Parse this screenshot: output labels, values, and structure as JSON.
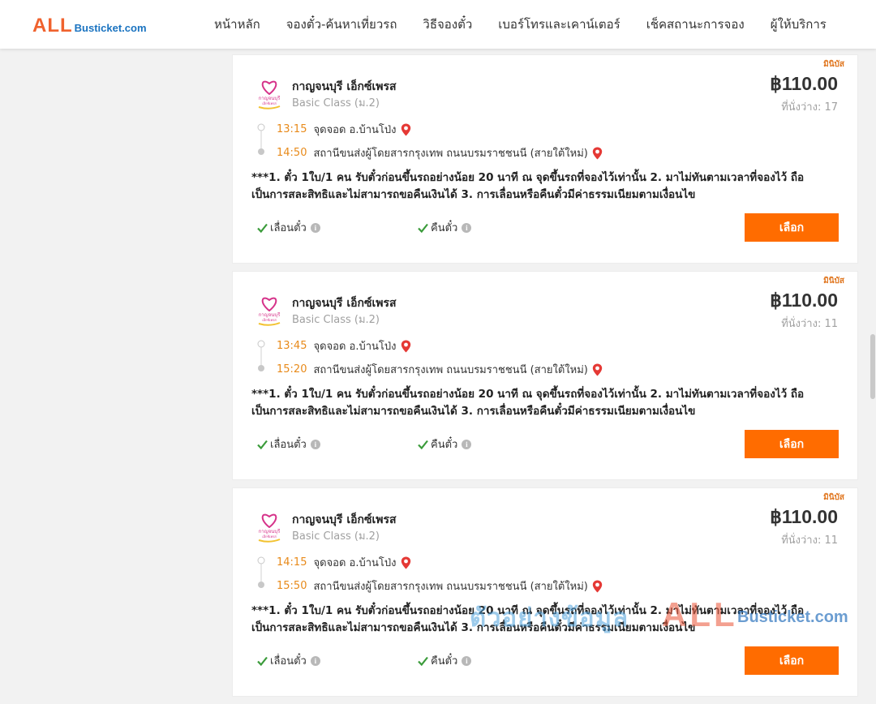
{
  "header": {
    "logo_all": "ALL",
    "logo_rest": "Busticket.com",
    "nav": [
      "หน้าหลัก",
      "จองตั๋ว-ค้นหาเที่ยวรถ",
      "วิธีจองตั๋ว",
      "เบอร์โทรและเคาน์เตอร์",
      "เช็คสถานะการจอง",
      "ผู้ให้บริการ"
    ]
  },
  "colors": {
    "accent_orange": "#ff6c00",
    "time_orange": "#e88a1a",
    "check_green": "#3a9b3a",
    "pin_red": "#e53935",
    "logo_red": "#f0622e",
    "logo_blue": "#1a73c0"
  },
  "cards": [
    {
      "tag": "มินิบัส",
      "operator": "กาญจนบุรี เอ็กซ์เพรส",
      "bus_class": "Basic Class (ม.2)",
      "price": "฿110.00",
      "seats": "ที่นั่งว่าง: 17",
      "dep_time": "13:15",
      "dep_place": "จุดจอด อ.บ้านโป่ง",
      "arr_time": "14:50",
      "arr_place": "สถานีขนส่งผู้โดยสารกรุงเทพ ถนนบรมราชชนนี (สายใต้ใหม่)",
      "note": "***1. ตั๋ว 1ใบ/1 คน รับตั๋วก่อนขึ้นรถอย่างน้อย 20 นาที ณ จุดขึ้นรถที่จองไว้เท่านั้น 2. มาไม่ทันตามเวลาที่จองไว้ ถือเป็นการสละสิทธิและไม่สามารถขอคืนเงินได้ 3. การเลื่อนหรือคืนตั๋วมีค่าธรรมเนียมตามเงื่อนไข",
      "feature1": "เลื่อนตั๋ว",
      "feature2": "คืนตั๋ว",
      "button": "เลือก"
    },
    {
      "tag": "มินิบัส",
      "operator": "กาญจนบุรี เอ็กซ์เพรส",
      "bus_class": "Basic Class (ม.2)",
      "price": "฿110.00",
      "seats": "ที่นั่งว่าง: 11",
      "dep_time": "13:45",
      "dep_place": "จุดจอด อ.บ้านโป่ง",
      "arr_time": "15:20",
      "arr_place": "สถานีขนส่งผู้โดยสารกรุงเทพ ถนนบรมราชชนนี (สายใต้ใหม่)",
      "note": "***1. ตั๋ว 1ใบ/1 คน รับตั๋วก่อนขึ้นรถอย่างน้อย 20 นาที ณ จุดขึ้นรถที่จองไว้เท่านั้น 2. มาไม่ทันตามเวลาที่จองไว้ ถือเป็นการสละสิทธิและไม่สามารถขอคืนเงินได้ 3. การเลื่อนหรือคืนตั๋วมีค่าธรรมเนียมตามเงื่อนไข",
      "feature1": "เลื่อนตั๋ว",
      "feature2": "คืนตั๋ว",
      "button": "เลือก"
    },
    {
      "tag": "มินิบัส",
      "operator": "กาญจนบุรี เอ็กซ์เพรส",
      "bus_class": "Basic Class (ม.2)",
      "price": "฿110.00",
      "seats": "ที่นั่งว่าง: 11",
      "dep_time": "14:15",
      "dep_place": "จุดจอด อ.บ้านโป่ง",
      "arr_time": "15:50",
      "arr_place": "สถานีขนส่งผู้โดยสารกรุงเทพ ถนนบรมราชชนนี (สายใต้ใหม่)",
      "note": "***1. ตั๋ว 1ใบ/1 คน รับตั๋วก่อนขึ้นรถอย่างน้อย 20 นาที ณ จุดขึ้นรถที่จองไว้เท่านั้น 2. มาไม่ทันตามเวลาที่จองไว้ ถือเป็นการสละสิทธิและไม่สามารถขอคืนเงินได้ 3. การเลื่อนหรือคืนตั๋วมีค่าธรรมเนียมตามเงื่อนไข",
      "feature1": "เลื่อนตั๋ว",
      "feature2": "คืนตั๋ว",
      "button": "เลือก"
    }
  ],
  "watermark": {
    "text": "ตัวอย่างข้อมูล",
    "all": "ALL",
    "brand": "Busticket.com"
  }
}
